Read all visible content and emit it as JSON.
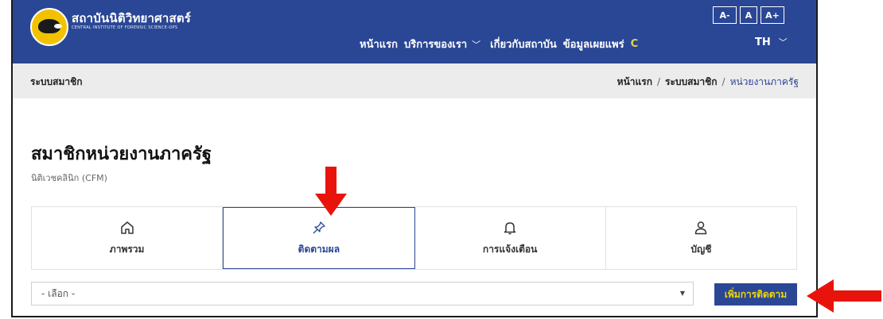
{
  "header": {
    "brand_th": "สถาบันนิติวิทยาศาสตร์",
    "brand_en": "CENTRAL INSTITUTE OF FORENSIC SCIENCE-OPS",
    "nav": [
      {
        "label": "หน้าแรก",
        "has_dropdown": false
      },
      {
        "label": "บริการของเรา",
        "has_dropdown": true
      },
      {
        "label": "เกี่ยวกับสถาบัน",
        "has_dropdown": false
      },
      {
        "label": "ข้อมูลเผยแพร่",
        "has_dropdown": false
      }
    ],
    "nav_more": "C",
    "font_buttons": [
      "A-",
      "A",
      "A+"
    ],
    "language": "TH"
  },
  "breadcrumb_bar": {
    "section": "ระบบสมาชิก",
    "trail": [
      "หน้าแรก",
      "ระบบสมาชิก",
      "หน่วยงานภาครัฐ"
    ]
  },
  "page": {
    "title": "สมาชิกหน่วยงานภาครัฐ",
    "subtitle": "นิติเวชคลินิก (CFM)"
  },
  "tabs": [
    {
      "label": "ภาพรวม",
      "icon": "home-icon",
      "active": false
    },
    {
      "label": "ติดตามผล",
      "icon": "pin-icon",
      "active": true
    },
    {
      "label": "การแจ้งเตือน",
      "icon": "bell-icon",
      "active": false
    },
    {
      "label": "บัญชี",
      "icon": "user-icon",
      "active": false
    }
  ],
  "filter": {
    "select_value": "- เลือก -",
    "add_button": "เพิ่มการติดตาม"
  },
  "colors": {
    "header_bg": "#2a4796",
    "accent_yellow": "#f2d600",
    "annotation_red": "#e8140c",
    "breadcrumb_bg": "#ececec"
  }
}
